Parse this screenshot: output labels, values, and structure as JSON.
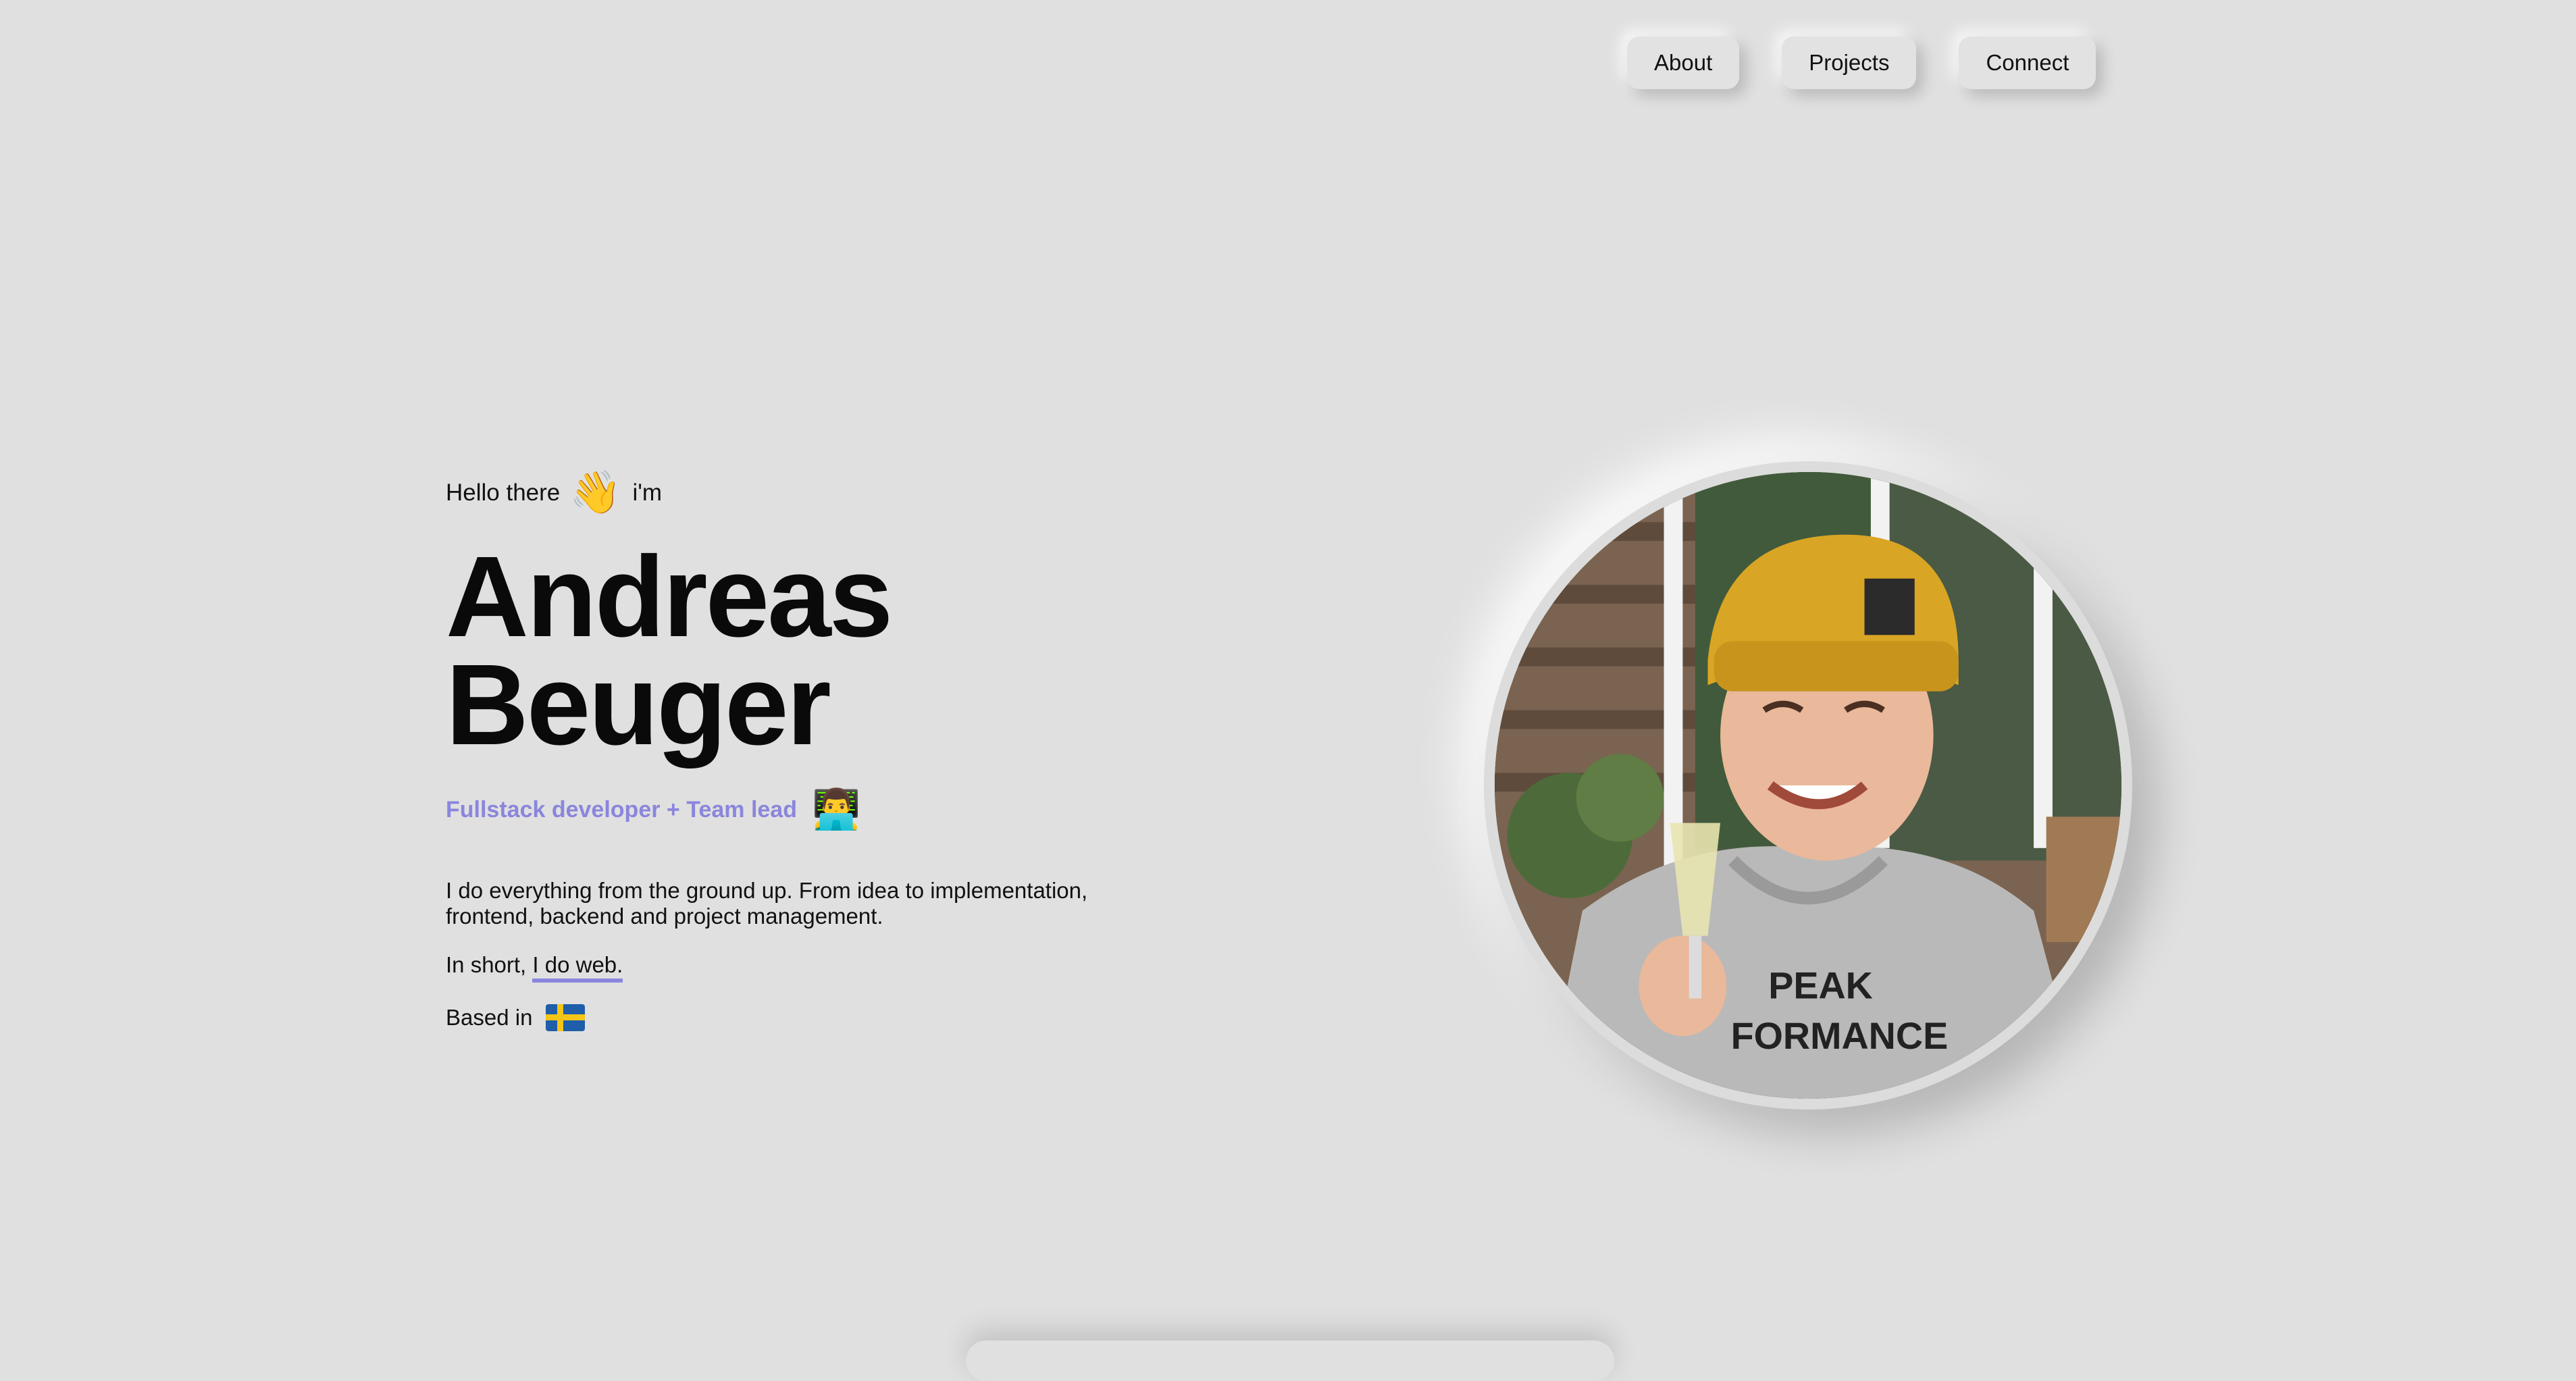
{
  "nav": {
    "items": [
      {
        "label": "About"
      },
      {
        "label": "Projects"
      },
      {
        "label": "Connect"
      }
    ]
  },
  "hero": {
    "greeting_before": "Hello there",
    "greeting_emoji": "👋",
    "greeting_after": "i'm",
    "name_first": "Andreas",
    "name_last": "Beuger",
    "role": "Fullstack developer + Team lead",
    "role_emoji": "👨‍💻",
    "description": "I do everything from the ground up. From idea to implementation, frontend, backend and project management.",
    "short_prefix": "In short,",
    "short_link": "I do web.",
    "based_label": "Based in",
    "based_flag_icon": "sweden-flag-icon"
  },
  "profile": {
    "photo_icon": "profile-photo"
  },
  "colors": {
    "background": "#e0e0e0",
    "accent": "#8a86dd",
    "text": "#111111"
  }
}
